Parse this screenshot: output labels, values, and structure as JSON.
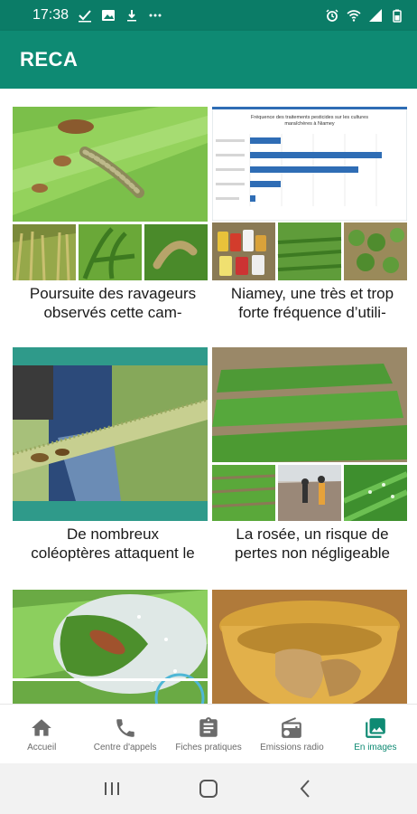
{
  "status_bar": {
    "time": "17:38",
    "icons_left": [
      "check-icon",
      "image-icon",
      "download-icon",
      "more-dots-icon"
    ],
    "icons_right": [
      "alarm-icon",
      "wifi-icon",
      "signal-icon",
      "battery-icon"
    ]
  },
  "app_bar": {
    "title": "RECA"
  },
  "articles": [
    {
      "title_line1": "Poursuite des ravageurs",
      "title_line2": "observés cette cam-"
    },
    {
      "title_line1": "Niamey, une très et trop",
      "title_line2": "forte fréquence d’utili-"
    },
    {
      "title_line1": "De nombreux",
      "title_line2": "coléoptères attaquent le"
    },
    {
      "title_line1": "La rosée, un risque de",
      "title_line2": "pertes non négligeable"
    },
    {
      "title_line1": "",
      "title_line2": ""
    },
    {
      "title_line1": "",
      "title_line2": ""
    }
  ],
  "chart_card": {
    "title_line1": "Fréquence des traitements pesticides sur les cultures",
    "title_line2": "maraîchères à Niamey"
  },
  "bottom_nav": {
    "items": [
      {
        "label": "Accueil",
        "icon": "home-icon",
        "active": false
      },
      {
        "label": "Centre d'appels",
        "icon": "phone-icon",
        "active": false
      },
      {
        "label": "Fiches pratiques",
        "icon": "clipboard-icon",
        "active": false
      },
      {
        "label": "Emissions radio",
        "icon": "radio-icon",
        "active": false
      },
      {
        "label": "En images",
        "icon": "gallery-icon",
        "active": true
      }
    ]
  },
  "colors": {
    "primary": "#0e8a73",
    "status_bar": "#0b7c67",
    "nav_active": "#0e8a73",
    "nav_inactive": "#6b6b6b"
  }
}
